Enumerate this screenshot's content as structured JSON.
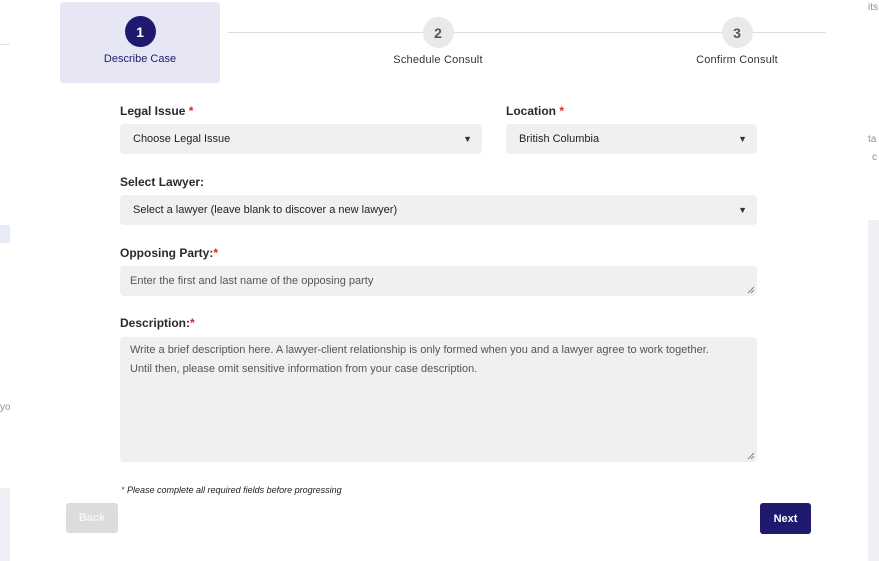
{
  "background": {
    "frag_top_right": "its",
    "frag_right_1": "ta",
    "frag_right_2": "c",
    "frag_left": "yo"
  },
  "stepper": {
    "steps": [
      {
        "number": "1",
        "label": "Describe Case",
        "active": true
      },
      {
        "number": "2",
        "label": "Schedule Consult",
        "active": false
      },
      {
        "number": "3",
        "label": "Confirm Consult",
        "active": false
      }
    ]
  },
  "form": {
    "legal_issue": {
      "label": "Legal Issue",
      "required_mark": "*",
      "value": "Choose Legal Issue"
    },
    "location": {
      "label": "Location",
      "required_mark": "*",
      "value": "British Columbia"
    },
    "lawyer": {
      "label": "Select Lawyer:",
      "value": "Select a lawyer (leave blank to discover a new lawyer)"
    },
    "opposing_party": {
      "label": "Opposing Party:",
      "required_mark": "*",
      "placeholder": "Enter the first and last name of the opposing party"
    },
    "description": {
      "label": "Description:",
      "required_mark": "*",
      "placeholder_line1": "Write a brief description here. A lawyer-client relationship is only formed when you and a lawyer agree to work together.",
      "placeholder_line2": "Until then, please omit sensitive information from your case description."
    },
    "required_note": {
      "mark": "*",
      "text": " Please complete all required fields before progressing"
    }
  },
  "buttons": {
    "back": "Back",
    "next": "Next"
  },
  "colors": {
    "accent": "#1f1a6f",
    "active_step_bg": "#e7e6f4",
    "field_bg": "#f0f0f0",
    "required": "#d12a2a"
  }
}
